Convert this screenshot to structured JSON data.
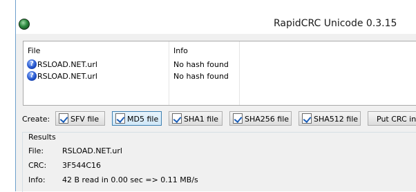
{
  "window": {
    "title": "RapidCRC Unicode 0.3.15"
  },
  "listview": {
    "columns": [
      "File",
      "Info"
    ],
    "rows": [
      {
        "file": "RSLOAD.NET.url",
        "info": "No hash found",
        "icon": "question-icon"
      },
      {
        "file": "RSLOAD.NET.url",
        "info": "No hash found",
        "icon": "question-icon"
      }
    ]
  },
  "create": {
    "label": "Create:",
    "buttons": [
      "SFV file",
      "MD5 file",
      "SHA1 file",
      "SHA256 file",
      "SHA512 file",
      "Put CRC into"
    ]
  },
  "results": {
    "title": "Results",
    "file_label": "File:",
    "file_value": "RSLOAD.NET.url",
    "crc_label": "CRC:",
    "crc_value": "3F544C16",
    "info_label": "Info:",
    "info_value": "42 B read in 0.00 sec => 0.11 MB/s"
  }
}
